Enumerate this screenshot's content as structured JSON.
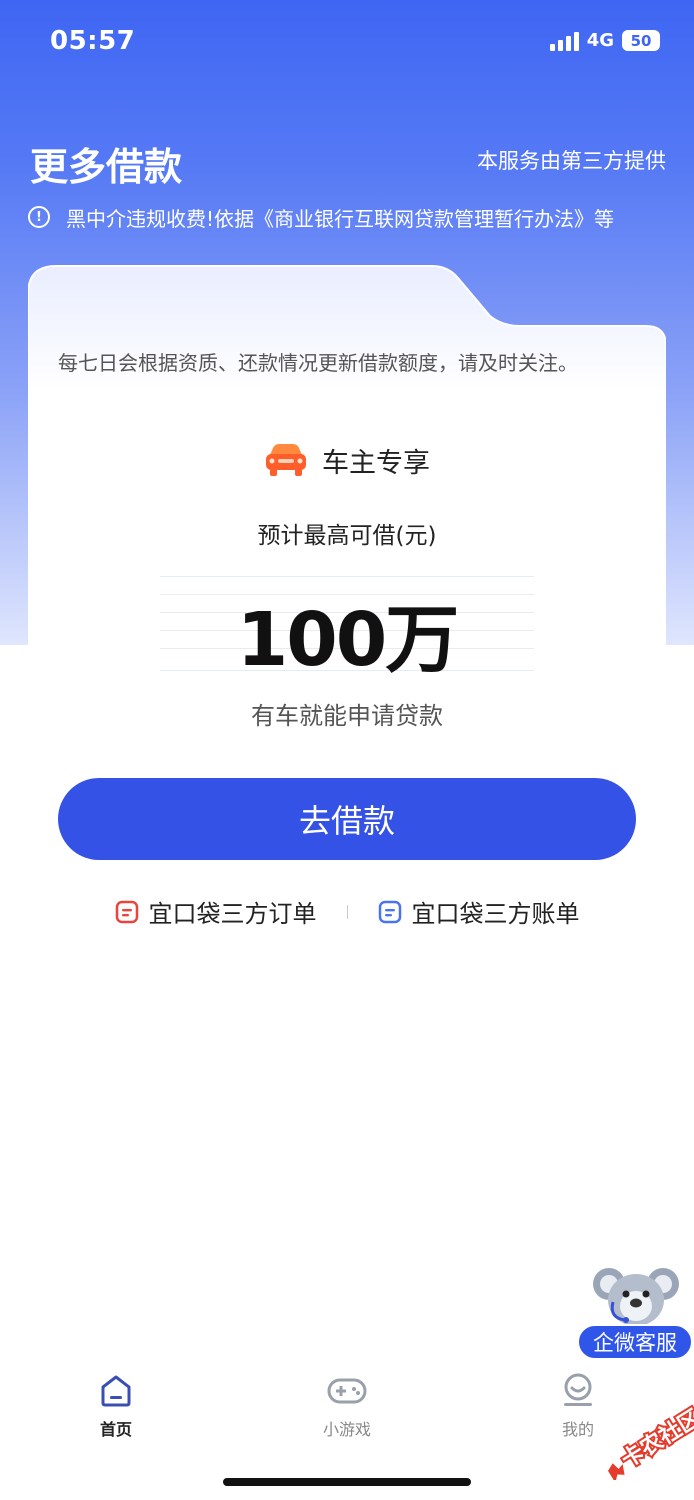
{
  "status_bar": {
    "time": "05:57",
    "network": "4G",
    "battery": "50"
  },
  "header": {
    "title": "更多借款",
    "provider_note": "本服务由第三方提供",
    "notice": "黑中介违规收费!依据《商业银行互联网贷款管理暂行办法》等"
  },
  "card": {
    "description": "每七日会根据资质、还款情况更新借款额度，请及时关注。",
    "badge_icon": "car-icon",
    "badge_label": "车主专享",
    "amount_caption": "预计最高可借(元)",
    "amount_value": "100万",
    "amount_sub": "有车就能申请贷款",
    "button_label": "去借款",
    "links": [
      {
        "label": "宜口袋三方订单",
        "icon": "red-doc-icon",
        "color": "#e8453c"
      },
      {
        "label": "宜口袋三方账单",
        "icon": "blue-doc-icon",
        "color": "#4a73f0"
      }
    ]
  },
  "service_widget": {
    "label": "企微客服",
    "icon": "koala-icon"
  },
  "tab_bar": {
    "items": [
      {
        "label": "首页",
        "icon": "home-icon",
        "active": true
      },
      {
        "label": "小游戏",
        "icon": "gamepad-icon",
        "active": false
      },
      {
        "label": "我的",
        "icon": "profile-icon",
        "active": false
      }
    ]
  },
  "watermark": {
    "text": "卡农社区"
  },
  "colors": {
    "brand": "#3552e6",
    "hero_top": "#3f66f3",
    "link_red": "#e8453c",
    "link_blue": "#4a73f0"
  }
}
